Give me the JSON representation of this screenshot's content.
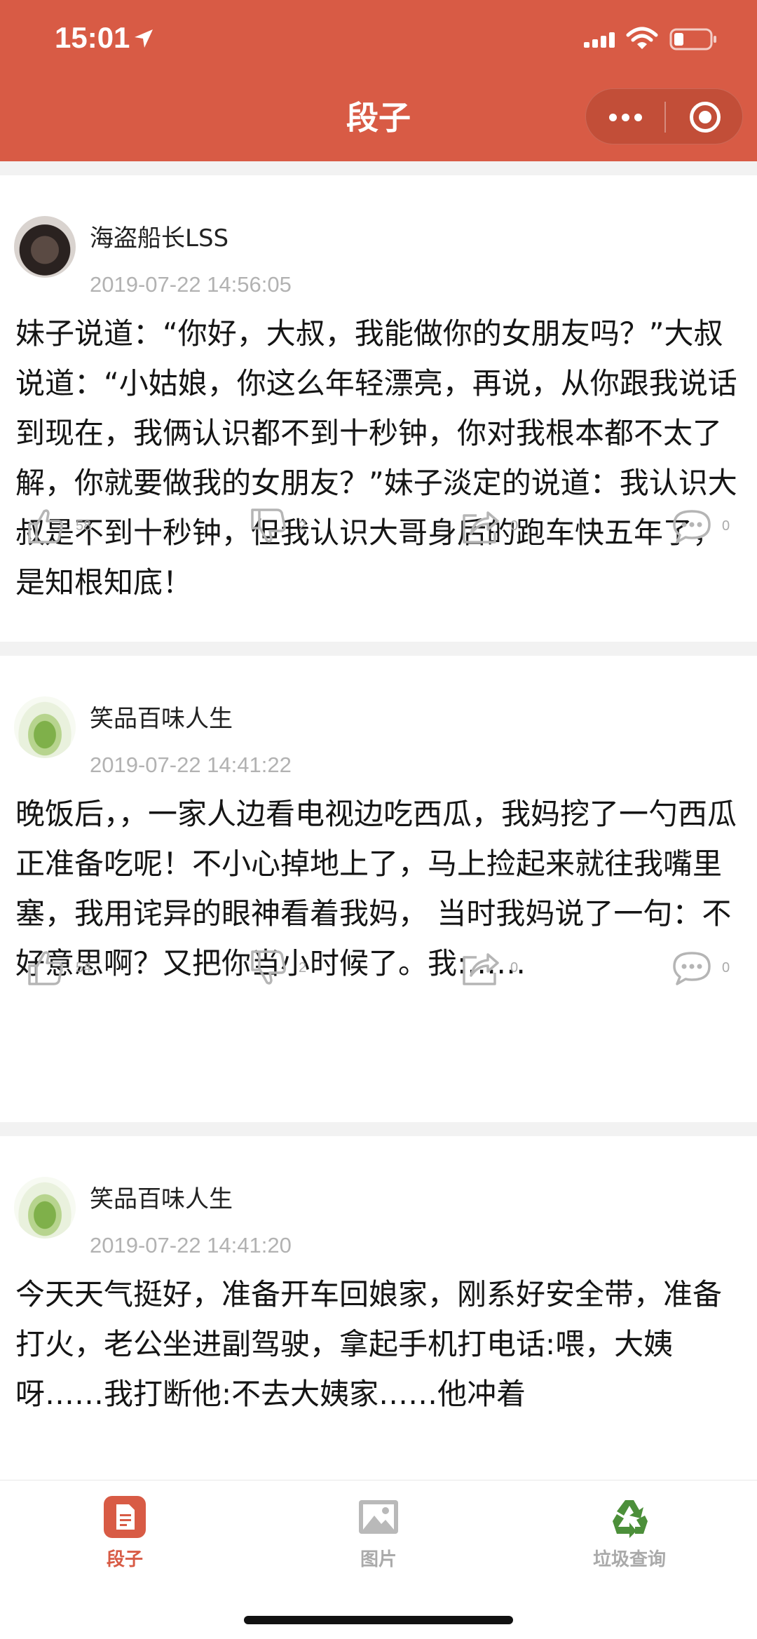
{
  "status_bar": {
    "time": "15:01"
  },
  "header": {
    "title": "段子",
    "accent_color": "#d85b45"
  },
  "posts": [
    {
      "username": "海盗船长LSS",
      "timestamp": "2019-07-22 14:56:05",
      "content": "妹子说道：“你好，大叔，我能做你的女朋友吗？”大叔说道：“小姑娘，你这么年轻漂亮，再说，从你跟我说话到现在，我俩认识都不到十秒钟，你对我根本都不太了解，你就要做我的女朋友？”妹子淡定的说道：我认识大叔是不到十秒钟，但我认识大哥身后的跑车快五年了，是知根知底！",
      "likes": "58",
      "dislikes": "2",
      "shares": "0",
      "comments": "0"
    },
    {
      "username": "笑品百味人生",
      "timestamp": "2019-07-22 14:41:22",
      "content": "晚饭后，，一家人边看电视边吃西瓜，我妈挖了一勺西瓜正准备吃呢！不小心掉地上了，马上捡起来就往我嘴里塞，我用诧异的眼神看着我妈， 当时我妈说了一句：不好意思啊？又把你当小时候了。我:……",
      "likes": "54",
      "dislikes": "2",
      "shares": "0",
      "comments": "0"
    },
    {
      "username": "笑品百味人生",
      "timestamp": "2019-07-22 14:41:20",
      "content": "今天天气挺好，准备开车回娘家，刚系好安全带，准备打火，老公坐进副驾驶，拿起手机打电话:喂，大姨呀……我打断他:不去大姨家……他冲着",
      "likes": "",
      "dislikes": "",
      "shares": "",
      "comments": ""
    }
  ],
  "tabbar": {
    "items": [
      {
        "label": "段子",
        "icon": "document-icon",
        "active": true
      },
      {
        "label": "图片",
        "icon": "image-icon",
        "active": false
      },
      {
        "label": "垃圾查询",
        "icon": "recycle-icon",
        "active": false
      }
    ]
  }
}
